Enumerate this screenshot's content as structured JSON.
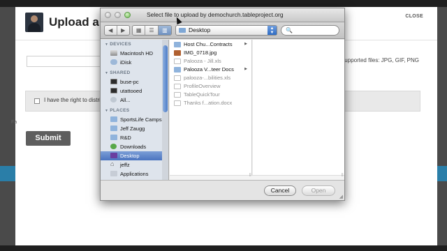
{
  "page": {
    "modal_title": "Upload a",
    "close_label": "CLOSE",
    "supported_files": "Supported files: JPG, GIF, PNG",
    "rights_text": "I have the right to distrib",
    "fa_text": "Fa",
    "submit_label": "Submit"
  },
  "dialog": {
    "title": "Select file to upload by demochurch.tableproject.org",
    "location": "Desktop",
    "search_icon": "magnifier-icon",
    "view_modes": [
      "icon-view-icon",
      "list-view-icon",
      "column-view-icon"
    ],
    "sidebar": {
      "devices_label": "DEVICES",
      "devices": [
        "Macintosh HD",
        "iDisk"
      ],
      "shared_label": "SHARED",
      "shared": [
        "buse-pc",
        "utattooed",
        "All..."
      ],
      "places_label": "PLACES",
      "places": [
        "SportsLife Camps",
        "Jeff Zaugg",
        "R&D",
        "Downloads",
        "Desktop",
        "jeffz",
        "Applications"
      ]
    },
    "files": [
      {
        "name": "Host Chu...Contracts",
        "kind": "folder",
        "enabled": true
      },
      {
        "name": "IMG_0718.jpg",
        "kind": "jpg",
        "enabled": true
      },
      {
        "name": "Palooza - Jill.xls",
        "kind": "doc",
        "enabled": false
      },
      {
        "name": "Palooza V...teer Docs",
        "kind": "folder",
        "enabled": true
      },
      {
        "name": "palooza-...bilities.xls",
        "kind": "doc",
        "enabled": false
      },
      {
        "name": "ProfileOverview",
        "kind": "doc",
        "enabled": false
      },
      {
        "name": "TableQuickTour",
        "kind": "doc",
        "enabled": false
      },
      {
        "name": "Thanks f...ation.docx",
        "kind": "doc",
        "enabled": false
      }
    ],
    "cancel_label": "Cancel",
    "open_label": "Open"
  }
}
